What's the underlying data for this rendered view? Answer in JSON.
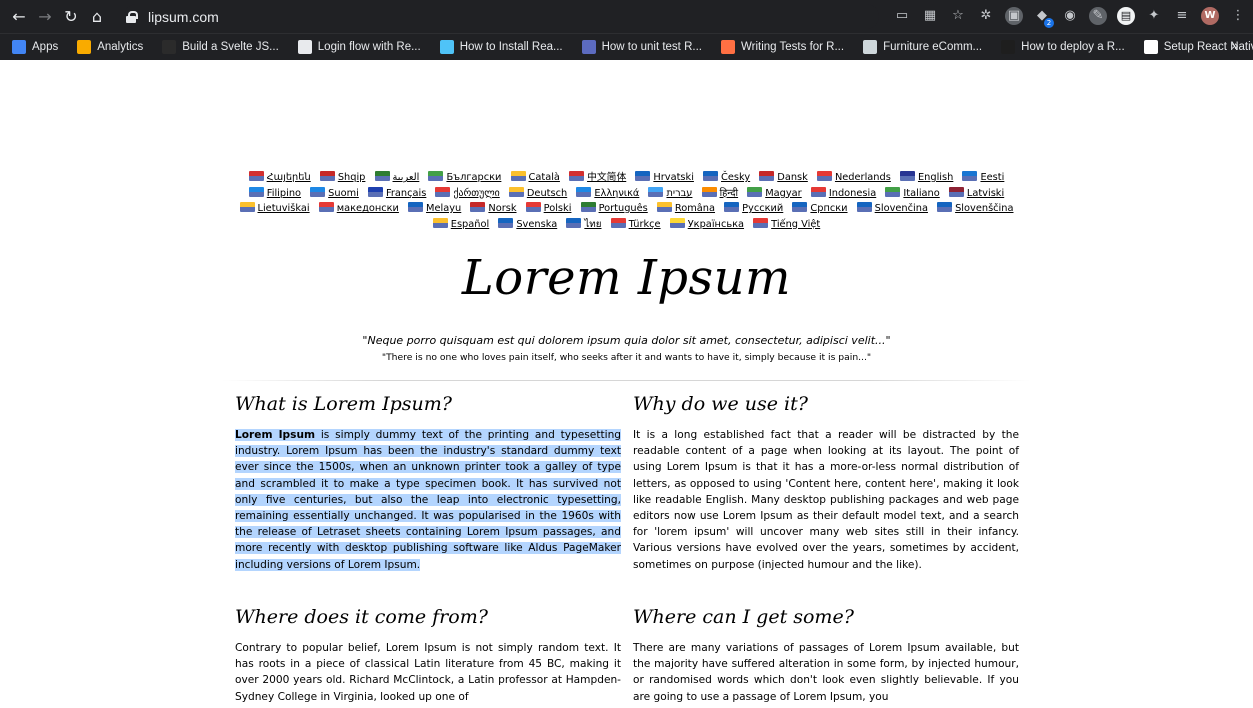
{
  "browser": {
    "url": "lipsum.com",
    "bookmarks": [
      {
        "label": "Apps",
        "color": "#4285f4"
      },
      {
        "label": "Analytics",
        "color": "#f9ab00"
      },
      {
        "label": "Build a Svelte JS...",
        "color": "#2b2b2b"
      },
      {
        "label": "Login flow with Re...",
        "color": "#e8eaed"
      },
      {
        "label": "How to Install Rea...",
        "color": "#4fc3f7"
      },
      {
        "label": "How to unit test R...",
        "color": "#5c6bc0"
      },
      {
        "label": "Writing Tests for R...",
        "color": "#ff7043"
      },
      {
        "label": "Furniture eComm...",
        "color": "#cfd8dc"
      },
      {
        "label": "How to deploy a R...",
        "color": "#1e1e1e"
      },
      {
        "label": "Setup React Nativ...",
        "color": "#ffffff"
      }
    ],
    "more": "»",
    "avatar": "W"
  },
  "languages": [
    {
      "name": "Հայերեն",
      "flag": "#d32f2f"
    },
    {
      "name": "Shqip",
      "flag": "#c62828"
    },
    {
      "name": "العربية",
      "flag": "#2e7d32"
    },
    {
      "name": "Български",
      "flag": "#43a047"
    },
    {
      "name": "Català",
      "flag": "#fbc02d"
    },
    {
      "name": "中文简体",
      "flag": "#d32f2f"
    },
    {
      "name": "Hrvatski",
      "flag": "#1565c0"
    },
    {
      "name": "Česky",
      "flag": "#1565c0"
    },
    {
      "name": "Dansk",
      "flag": "#c62828"
    },
    {
      "name": "Nederlands",
      "flag": "#e53935"
    },
    {
      "name": "English",
      "flag": "#283593"
    },
    {
      "name": "Eesti",
      "flag": "#1976d2"
    },
    {
      "name": "Filipino",
      "flag": "#1e88e5"
    },
    {
      "name": "Suomi",
      "flag": "#1e88e5"
    },
    {
      "name": "Français",
      "flag": "#1e40af"
    },
    {
      "name": "ქართული",
      "flag": "#e53935"
    },
    {
      "name": "Deutsch",
      "flag": "#fbc02d"
    },
    {
      "name": "Ελληνικά",
      "flag": "#1e88e5"
    },
    {
      "name": "עברית",
      "flag": "#42a5f5"
    },
    {
      "name": "हिन्दी",
      "flag": "#fb8c00"
    },
    {
      "name": "Magyar",
      "flag": "#43a047"
    },
    {
      "name": "Indonesia",
      "flag": "#e53935"
    },
    {
      "name": "Italiano",
      "flag": "#43a047"
    },
    {
      "name": "Latviski",
      "flag": "#8e2435"
    },
    {
      "name": "Lietuviškai",
      "flag": "#fbc02d"
    },
    {
      "name": "македонски",
      "flag": "#e53935"
    },
    {
      "name": "Melayu",
      "flag": "#1565c0"
    },
    {
      "name": "Norsk",
      "flag": "#c62828"
    },
    {
      "name": "Polski",
      "flag": "#e53935"
    },
    {
      "name": "Português",
      "flag": "#2e7d32"
    },
    {
      "name": "Româna",
      "flag": "#fbc02d"
    },
    {
      "name": "Pусский",
      "flag": "#1565c0"
    },
    {
      "name": "Српски",
      "flag": "#1565c0"
    },
    {
      "name": "Slovenčina",
      "flag": "#1565c0"
    },
    {
      "name": "Slovenščina",
      "flag": "#1565c0"
    },
    {
      "name": "Español",
      "flag": "#fbc02d"
    },
    {
      "name": "Svenska",
      "flag": "#1565c0"
    },
    {
      "name": "ไทย",
      "flag": "#1565c0"
    },
    {
      "name": "Türkçe",
      "flag": "#e53935"
    },
    {
      "name": "Українська",
      "flag": "#fdd835"
    },
    {
      "name": "Tiếng Việt",
      "flag": "#e53935"
    }
  ],
  "logo": "Lorem Ipsum",
  "quote_latin": "\"Neque porro quisquam est qui dolorem ipsum quia dolor sit amet, consectetur, adipisci velit...\"",
  "quote_english": "\"There is no one who loves pain itself, who seeks after it and wants to have it, simply because it is pain...\"",
  "sections": {
    "what": {
      "title": "What is Lorem Ipsum?",
      "lead": "Lorem Ipsum",
      "body": " is simply dummy text of the printing and typesetting industry. Lorem Ipsum has been the industry's standard dummy text ever since the 1500s, when an unknown printer took a galley of type and scrambled it to make a type specimen book. It has survived not only five centuries, but also the leap into electronic typesetting, remaining essentially unchanged. It was popularised in the 1960s with the release of Letraset sheets containing Lorem Ipsum passages, and more recently with desktop publishing software like Aldus PageMaker including versions of Lorem Ipsum."
    },
    "why": {
      "title": "Why do we use it?",
      "body": "It is a long established fact that a reader will be distracted by the readable content of a page when looking at its layout. The point of using Lorem Ipsum is that it has a more-or-less normal distribution of letters, as opposed to using 'Content here, content here', making it look like readable English. Many desktop publishing packages and web page editors now use Lorem Ipsum as their default model text, and a search for 'lorem ipsum' will uncover many web sites still in their infancy. Various versions have evolved over the years, sometimes by accident, sometimes on purpose (injected humour and the like)."
    },
    "where_from": {
      "title": "Where does it come from?",
      "body": "Contrary to popular belief, Lorem Ipsum is not simply random text. It has roots in a piece of classical Latin literature from 45 BC, making it over 2000 years old. Richard McClintock, a Latin professor at Hampden-Sydney College in Virginia, looked up one of"
    },
    "where_get": {
      "title": "Where can I get some?",
      "body": "There are many variations of passages of Lorem Ipsum available, but the majority have suffered alteration in some form, by injected humour, or randomised words which don't look even slightly believable. If you are going to use a passage of Lorem Ipsum, you"
    }
  }
}
